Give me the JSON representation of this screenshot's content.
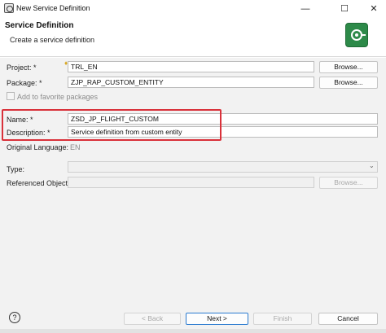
{
  "window": {
    "title": "New Service Definition",
    "minimize_glyph": "—",
    "maximize_glyph": "☐",
    "close_glyph": "✕"
  },
  "header": {
    "title": "Service Definition",
    "subtitle": "Create a service definition",
    "logo_color": "#2d8a49"
  },
  "form": {
    "project": {
      "label": "Project: *",
      "value": "TRL_EN",
      "browse": "Browse..."
    },
    "package": {
      "label": "Package: *",
      "value": "ZJP_RAP_CUSTOM_ENTITY",
      "browse": "Browse..."
    },
    "favorites": {
      "label": "Add to favorite packages",
      "checked": false
    },
    "name": {
      "label": "Name: *",
      "value": "ZSD_JP_FLIGHT_CUSTOM"
    },
    "description": {
      "label": "Description: *",
      "value": "Service definition from custom entity"
    },
    "original_language": {
      "label": "Original Language:",
      "value": "EN"
    },
    "type": {
      "label": "Type:",
      "value": "",
      "arrow": "⌄"
    },
    "referenced_object": {
      "label": "Referenced Object:",
      "value": "",
      "browse": "Browse..."
    }
  },
  "footer": {
    "help": "?",
    "back": "< Back",
    "next": "Next >",
    "finish": "Finish",
    "cancel": "Cancel"
  },
  "highlight_color": "#d9313a"
}
